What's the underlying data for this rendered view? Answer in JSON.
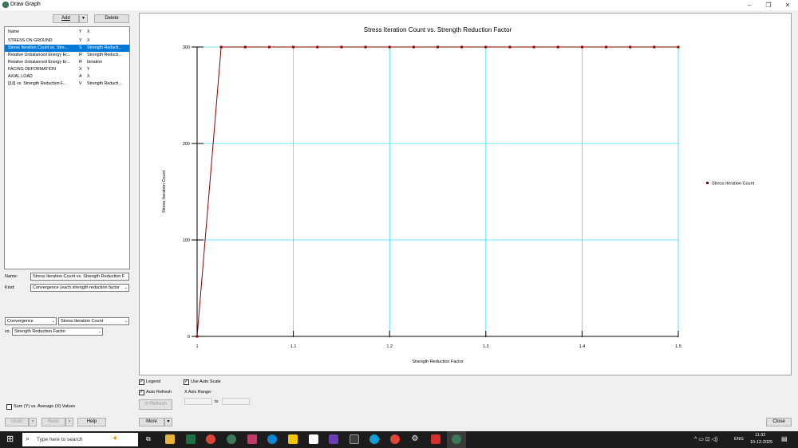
{
  "window": {
    "title": "Draw Graph"
  },
  "toolbar": {
    "add_label": "Add",
    "delete_label": "Delete"
  },
  "graph_list": {
    "headers": [
      "Name",
      "Y",
      "X"
    ],
    "rows": [
      {
        "name": "STRESS ON GROUND",
        "y": "Y",
        "x": "X",
        "selected": false
      },
      {
        "name": "Stress Iteration Count vs. Stre...",
        "y": "S",
        "x": "Strength Reducti...",
        "selected": true
      },
      {
        "name": "Relative Unbalanced Energy Er...",
        "y": "R",
        "x": "Strength Reducti...",
        "selected": false
      },
      {
        "name": "Relative Unbalanced Energy Er...",
        "y": "R",
        "x": "Iteration",
        "selected": false
      },
      {
        "name": "FACING DEFORMATION",
        "y": "X",
        "x": "Y",
        "selected": false
      },
      {
        "name": "AXIAL LOAD",
        "y": "A",
        "x": "X",
        "selected": false
      },
      {
        "name": "|[U]| vs. Strength Reduction F...",
        "y": "V",
        "x": "Strength Reducti...",
        "selected": false
      }
    ]
  },
  "props": {
    "name_label": "Name:",
    "name_value": "Stress Iteration Count vs. Strength Reduction F",
    "kind_label": "Kind:",
    "kind_value": "Convergence (each strength reduction factor"
  },
  "series_select": {
    "category": "Convergence",
    "y_value": "Stress Iteration Count",
    "vs_label": "vs.",
    "x_value": "Strength Reduction Factor"
  },
  "options": {
    "sum_label": "Sum (Y) vs. Average (X) Values",
    "legend_label": "Legend",
    "auto_refresh_label": "Auto Refresh",
    "refresh_label": "Refresh",
    "use_auto_scale_label": "Use Auto Scale",
    "x_axis_range_label": "X Axis Range:",
    "to_label": "to"
  },
  "bottom": {
    "undo_label": "Undo",
    "redo_label": "Redo",
    "help_label": "Help",
    "more_label": "More",
    "close_label": "Close"
  },
  "chart_data": {
    "type": "line",
    "title": "Stress Iteration Count vs. Strength Reduction Factor",
    "xlabel": "Strength Reduction Factor",
    "ylabel": "Stress Iteration Count",
    "xlim": [
      1,
      1.5
    ],
    "ylim": [
      0,
      300
    ],
    "x_ticks": [
      "1",
      "1.1",
      "1.2",
      "1.3",
      "1.4",
      "1.5"
    ],
    "y_ticks": [
      "0",
      "100",
      "200",
      "300"
    ],
    "grid": true,
    "legend_position": "right",
    "series": [
      {
        "name": "Stress Iteration Count",
        "color": "#8b0000",
        "x": [
          1,
          1.025,
          1.05,
          1.075,
          1.1,
          1.125,
          1.15,
          1.175,
          1.2,
          1.225,
          1.25,
          1.275,
          1.3,
          1.325,
          1.35,
          1.375,
          1.4,
          1.425,
          1.45,
          1.475,
          1.5
        ],
        "y": [
          0,
          300,
          300,
          300,
          300,
          300,
          300,
          300,
          300,
          300,
          300,
          300,
          300,
          300,
          300,
          300,
          300,
          300,
          300,
          300,
          300
        ]
      }
    ]
  },
  "taskbar": {
    "search_placeholder": "Type here to search",
    "time": "11:32",
    "date": "10-12-2025",
    "lang": "ENG"
  }
}
